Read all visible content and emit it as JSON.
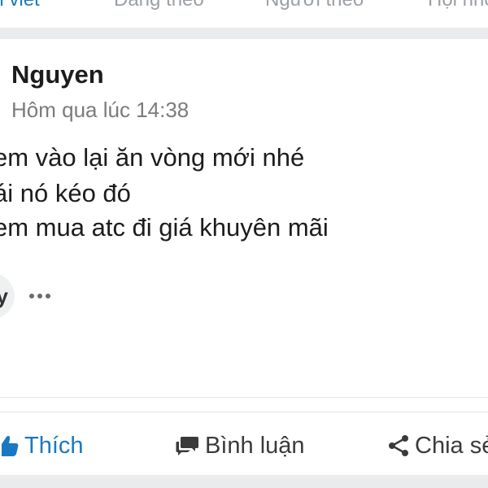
{
  "tabs": [
    {
      "label": "Bài viết",
      "active": true
    },
    {
      "label": "Đang theo",
      "active": false
    },
    {
      "label": "Người theo",
      "active": false
    },
    {
      "label": "Hội nhóm",
      "active": false
    }
  ],
  "post": {
    "author": "Nguyen",
    "timestamp": "Hôm qua lúc 14:38",
    "lines": [
      "em vào lại ăn vòng mới nhé",
      "ái nó kéo đó",
      "em mua atc đi giá khuyên mãi"
    ],
    "reaction_glyph": "y"
  },
  "actions": {
    "like_label": "Thích",
    "comment_label": "Bình luận",
    "share_label": "Chia sẻ"
  },
  "icons": {
    "like": "thumbs-up-icon",
    "comment": "speech-bubble-icon",
    "share": "share-nodes-icon",
    "more": "more-dots-icon"
  },
  "colors": {
    "accent": "#1a78c2",
    "text": "#1c1c1c",
    "muted": "#7b7b7b",
    "separator": "#e9ebed"
  }
}
